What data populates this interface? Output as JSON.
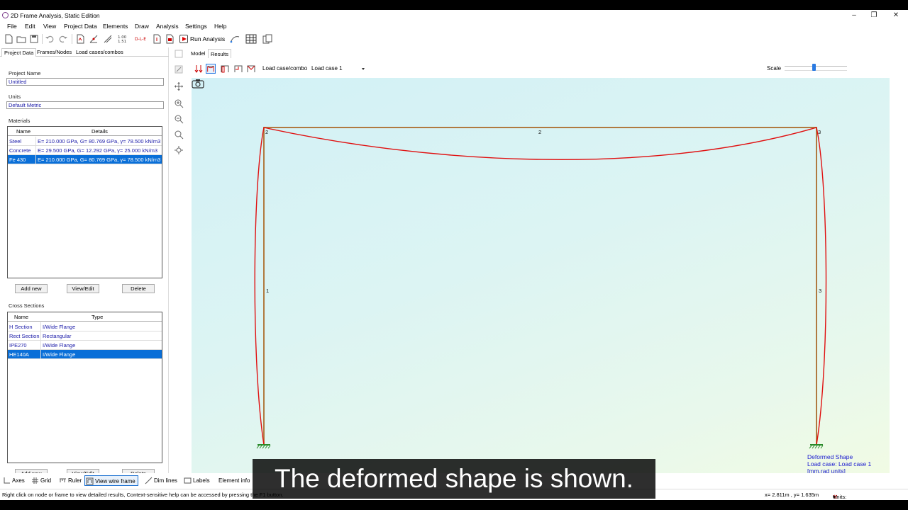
{
  "window": {
    "title": "2D Frame Analysis, Static Edition"
  },
  "menu": [
    "File",
    "Edit",
    "View",
    "Project Data",
    "Elements",
    "Draw",
    "Analysis",
    "Settings",
    "Help"
  ],
  "toolbar": {
    "run_label": "Run Analysis"
  },
  "left_tabs": [
    "Project Data",
    "Frames/Nodes",
    "Load cases/combos"
  ],
  "project": {
    "name_label": "Project Name",
    "name_value": "Untitled",
    "units_label": "Units",
    "units_value": "Default Metric"
  },
  "materials": {
    "label": "Materials",
    "headers": [
      "Name",
      "Details"
    ],
    "rows": [
      {
        "name": "Steel",
        "details": "E= 210.000 GPa, G= 80.769 GPa, γ= 78.500 kN/m3"
      },
      {
        "name": "Concrete",
        "details": "E= 29.500 GPa, G= 12.292 GPa, γ= 25.000 kN/m3"
      },
      {
        "name": "Fe 430",
        "details": "E= 210.000 GPa, G= 80.769 GPa, γ= 78.500 kN/m3"
      }
    ],
    "selected": 2
  },
  "sections": {
    "label": "Cross Sections",
    "headers": [
      "Name",
      "Type"
    ],
    "rows": [
      {
        "name": "H Section",
        "type": "I/Wide Flange"
      },
      {
        "name": "Rect Section",
        "type": "Rectangular"
      },
      {
        "name": "IPE270",
        "type": "I/Wide Flange"
      },
      {
        "name": "HE140A",
        "type": "I/Wide Flange"
      }
    ],
    "selected": 3
  },
  "buttons": {
    "add": "Add new",
    "edit": "View/Edit",
    "delete": "Delete"
  },
  "right_tabs": [
    "Model",
    "Results"
  ],
  "results": {
    "load_case_label": "Load case/combo",
    "load_case_value": "Load case 1",
    "scale_label": "Scale",
    "scale_level": 0.47
  },
  "nodes": [
    "2",
    "3"
  ],
  "members": [
    "1",
    "2",
    "3"
  ],
  "legend": [
    "Deformed Shape",
    "Load case: Load case 1",
    "[mm,rad units]"
  ],
  "bottom_toolbar": [
    "Axes",
    "Grid",
    "Ruler",
    "View wire frame",
    "Dim lines",
    "Labels",
    "Element info"
  ],
  "status": {
    "hint": "Right click on node or frame to view detailed results, Context-sensitive help can be accessed by pressing the F1 button.",
    "coords": "x= 2.811m , y= 1.635m",
    "units": "Units: Default Metric"
  },
  "subtitle": "The deformed shape is shown.",
  "colors": {
    "accent": "#0a6fd8",
    "frame": "#d01010",
    "legend": "#1a1ad0"
  }
}
